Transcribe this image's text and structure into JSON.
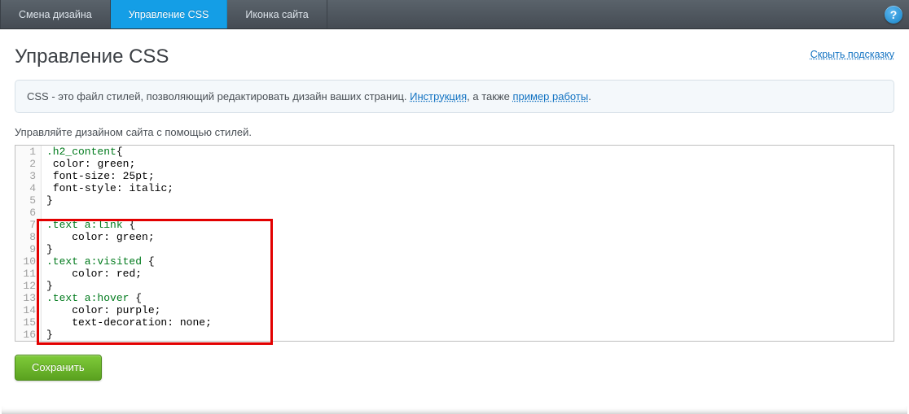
{
  "topbar": {
    "tabs": [
      {
        "label": "Смена дизайна",
        "active": false
      },
      {
        "label": "Управление CSS",
        "active": true
      },
      {
        "label": "Иконка сайта",
        "active": false
      }
    ],
    "help_glyph": "?"
  },
  "header": {
    "title": "Управление CSS",
    "hide_hint": "Скрыть подсказку"
  },
  "info": {
    "pre": "CSS - это файл стилей, позволяющий редактировать дизайн ваших страниц. ",
    "link1": "Инструкция",
    "mid": ", а также ",
    "link2": "пример работы",
    "post": "."
  },
  "sub_label": "Управляйте дизайном сайта с помощью стилей.",
  "code_lines": [
    {
      "n": 1,
      "tokens": [
        [
          "sel",
          ".h2_content"
        ],
        [
          "punct",
          "{"
        ]
      ]
    },
    {
      "n": 2,
      "tokens": [
        [
          "plain",
          " "
        ],
        [
          "prop",
          "color"
        ],
        [
          "punct",
          ": "
        ],
        [
          "val",
          "green"
        ],
        [
          "punct",
          ";"
        ]
      ]
    },
    {
      "n": 3,
      "tokens": [
        [
          "plain",
          " "
        ],
        [
          "prop",
          "font-size"
        ],
        [
          "punct",
          ": "
        ],
        [
          "val",
          "25pt"
        ],
        [
          "punct",
          ";"
        ]
      ]
    },
    {
      "n": 4,
      "tokens": [
        [
          "plain",
          " "
        ],
        [
          "prop",
          "font-style"
        ],
        [
          "punct",
          ": "
        ],
        [
          "val",
          "italic"
        ],
        [
          "punct",
          ";"
        ]
      ]
    },
    {
      "n": 5,
      "tokens": [
        [
          "punct",
          "}"
        ]
      ]
    },
    {
      "n": 6,
      "tokens": [
        [
          "plain",
          ""
        ]
      ]
    },
    {
      "n": 7,
      "tokens": [
        [
          "sel",
          ".text a"
        ],
        [
          "pseudo",
          ":link"
        ],
        [
          "plain",
          " "
        ],
        [
          "punct",
          "{"
        ]
      ]
    },
    {
      "n": 8,
      "tokens": [
        [
          "plain",
          "    "
        ],
        [
          "prop",
          "color"
        ],
        [
          "punct",
          ": "
        ],
        [
          "val",
          "green"
        ],
        [
          "punct",
          ";"
        ]
      ]
    },
    {
      "n": 9,
      "tokens": [
        [
          "punct",
          "}"
        ]
      ]
    },
    {
      "n": 10,
      "tokens": [
        [
          "sel",
          ".text a"
        ],
        [
          "pseudo",
          ":visited"
        ],
        [
          "plain",
          " "
        ],
        [
          "punct",
          "{"
        ]
      ]
    },
    {
      "n": 11,
      "tokens": [
        [
          "plain",
          "    "
        ],
        [
          "prop",
          "color"
        ],
        [
          "punct",
          ": "
        ],
        [
          "val",
          "red"
        ],
        [
          "punct",
          ";"
        ]
      ]
    },
    {
      "n": 12,
      "tokens": [
        [
          "punct",
          "}"
        ]
      ]
    },
    {
      "n": 13,
      "tokens": [
        [
          "sel",
          ".text a"
        ],
        [
          "pseudo",
          ":hover"
        ],
        [
          "plain",
          " "
        ],
        [
          "punct",
          "{"
        ]
      ]
    },
    {
      "n": 14,
      "tokens": [
        [
          "plain",
          "    "
        ],
        [
          "prop",
          "color"
        ],
        [
          "punct",
          ": "
        ],
        [
          "val",
          "purple"
        ],
        [
          "punct",
          ";"
        ]
      ]
    },
    {
      "n": 15,
      "tokens": [
        [
          "plain",
          "    "
        ],
        [
          "prop",
          "text-decoration"
        ],
        [
          "punct",
          ": "
        ],
        [
          "val",
          "none"
        ],
        [
          "punct",
          ";"
        ]
      ]
    },
    {
      "n": 16,
      "tokens": [
        [
          "punct",
          "}"
        ]
      ]
    }
  ],
  "actions": {
    "save": "Сохранить"
  },
  "colors": {
    "accent_blue": "#149ee6",
    "link_blue": "#1373c2",
    "save_green": "#5aa11f",
    "highlight_red": "#e20000"
  }
}
